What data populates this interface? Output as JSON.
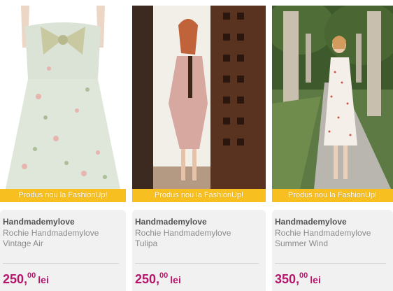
{
  "products": [
    {
      "badge": "Produs nou la FashionUp!",
      "brand": "Handmademylove",
      "name_line1": "Rochie Handmademylove",
      "name_line2": "Vintage Air",
      "price_int": "250,",
      "price_dec": "00",
      "currency": "lei"
    },
    {
      "badge": "Produs nou la FashionUp!",
      "brand": "Handmademylove",
      "name_line1": "Rochie Handmademylove",
      "name_line2": "Tulipa",
      "price_int": "250,",
      "price_dec": "00",
      "currency": "lei"
    },
    {
      "badge": "Produs nou la FashionUp!",
      "brand": "Handmademylove",
      "name_line1": "Rochie Handmademylove",
      "name_line2": "Summer Wind",
      "price_int": "350,",
      "price_dec": "00",
      "currency": "lei"
    }
  ],
  "colors": {
    "badge_bg": "#f7bf1f",
    "price": "#b5166b",
    "info_bg": "#f1f1f1"
  }
}
